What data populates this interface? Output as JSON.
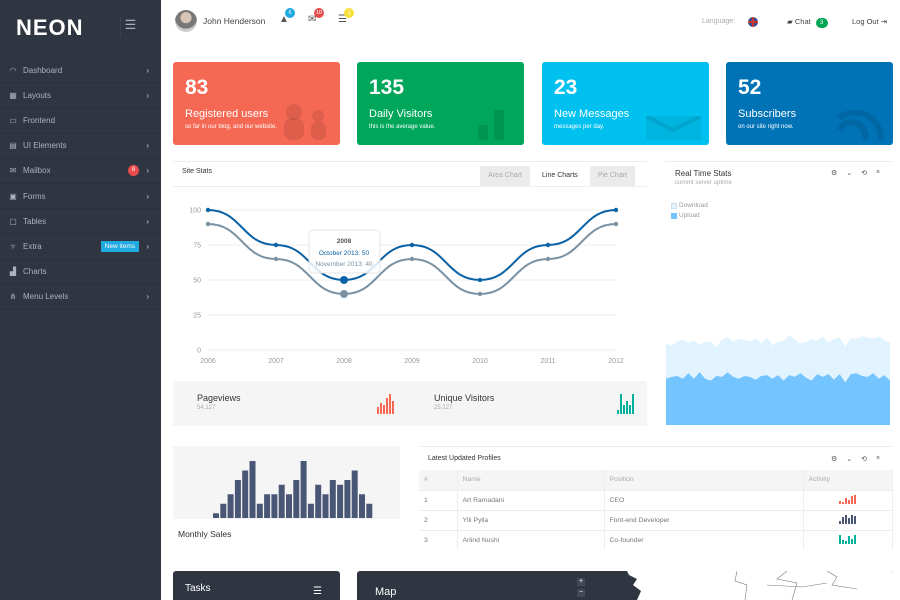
{
  "app": {
    "logo": "NEON",
    "menu_icon": "hamburger-icon"
  },
  "sidebar": {
    "items": [
      {
        "label": "Dashboard",
        "icon": "gauge-icon",
        "glyph": "◠",
        "chevron": true
      },
      {
        "label": "Layouts",
        "icon": "grid-icon",
        "glyph": "▦",
        "chevron": true
      },
      {
        "label": "Frontend",
        "icon": "monitor-icon",
        "glyph": "▭",
        "chevron": false
      },
      {
        "label": "UI Elements",
        "icon": "document-icon",
        "glyph": "▤",
        "chevron": true
      },
      {
        "label": "Mailbox",
        "icon": "mail-icon",
        "glyph": "✉",
        "chevron": true,
        "badge": "8"
      },
      {
        "label": "Forms",
        "icon": "form-icon",
        "glyph": "▣",
        "chevron": true
      },
      {
        "label": "Tables",
        "icon": "table-icon",
        "glyph": "▢",
        "chevron": true
      },
      {
        "label": "Extra",
        "icon": "box-icon",
        "glyph": "▿",
        "chevron": true,
        "tag": "New items"
      },
      {
        "label": "Charts",
        "icon": "bar-chart-icon",
        "glyph": "▟",
        "chevron": false
      },
      {
        "label": "Menu Levels",
        "icon": "sitemap-icon",
        "glyph": "⋔",
        "chevron": true
      }
    ]
  },
  "topbar": {
    "user": "John Henderson",
    "notifications": [
      {
        "icon": "alert-icon",
        "glyph": "▲",
        "count": "6",
        "color": "#21a9e1"
      },
      {
        "icon": "envelope-icon",
        "glyph": "✉",
        "count": "10",
        "color": "#e84c4c"
      },
      {
        "icon": "list-icon",
        "glyph": "☰",
        "count": "1",
        "color": "#f7e03a"
      }
    ],
    "language_label": "Language:",
    "chat_label": "Chat",
    "chat_count": "3",
    "logout_label": "Log Out"
  },
  "tiles": [
    {
      "value": "83",
      "title": "Registered users",
      "subtitle": "so far in our blog, and our website.",
      "color": "#f56954",
      "icon": "users-icon"
    },
    {
      "value": "135",
      "title": "Daily Visitors",
      "subtitle": "this is the average value.",
      "color": "#00a65a",
      "icon": "bar-chart-icon"
    },
    {
      "value": "23",
      "title": "New Messages",
      "subtitle": "messages per day.",
      "color": "#00c0ef",
      "icon": "envelope-icon"
    },
    {
      "value": "52",
      "title": "Subscribers",
      "subtitle": "on our site right now.",
      "color": "#0073b7",
      "icon": "rss-icon"
    }
  ],
  "site_stats": {
    "title": "Site Stats",
    "tabs": [
      "Area Chart",
      "Line Charts",
      "Pie Chart"
    ],
    "active_tab": 1,
    "tooltip": {
      "title": "2008",
      "line1": "October 2013: 50",
      "line2": "November 2013: 40"
    }
  },
  "chart_data": [
    {
      "type": "line",
      "title": "Site Stats",
      "x": [
        "2006",
        "2007",
        "2008",
        "2009",
        "2010",
        "2011",
        "2012"
      ],
      "series": [
        {
          "name": "October 2013",
          "values": [
            100,
            75,
            50,
            75,
            50,
            75,
            100
          ],
          "color": "#0b62a4"
        },
        {
          "name": "November 2013",
          "values": [
            90,
            65,
            40,
            65,
            40,
            65,
            90
          ],
          "color": "#7a92a3"
        }
      ],
      "yticks": [
        0,
        25,
        50,
        75,
        100
      ],
      "ylim": [
        0,
        100
      ],
      "grid": true,
      "highlight_index": 2
    },
    {
      "type": "area",
      "title": "Real Time Stats",
      "subtitle": "current server uptime",
      "legend": [
        "Download",
        "Upload"
      ],
      "legend_placement": "top-left",
      "series": [
        {
          "name": "Download",
          "color": "#e1f3ff",
          "values": [
            0.88,
            0.86,
            0.9,
            0.92,
            0.89,
            0.91,
            0.87,
            0.9,
            0.9,
            0.84,
            0.92,
            0.95,
            0.9,
            0.93,
            0.92,
            0.9,
            0.94,
            0.88,
            0.95,
            0.86,
            0.9,
            0.91,
            0.97,
            0.92,
            0.88,
            0.9,
            0.93,
            0.91,
            0.96,
            0.89,
            0.93,
            0.95,
            0.85,
            0.94,
            0.93,
            0.96,
            0.95,
            0.93,
            0.96,
            0.92,
            0.89
          ]
        },
        {
          "name": "Upload",
          "color": "#73c4ff",
          "values": [
            0.5,
            0.52,
            0.53,
            0.5,
            0.56,
            0.5,
            0.57,
            0.5,
            0.48,
            0.53,
            0.52,
            0.57,
            0.52,
            0.5,
            0.53,
            0.52,
            0.49,
            0.53,
            0.54,
            0.5,
            0.54,
            0.48,
            0.54,
            0.52,
            0.56,
            0.51,
            0.48,
            0.55,
            0.52,
            0.55,
            0.49,
            0.55,
            0.46,
            0.55,
            0.56,
            0.53,
            0.52,
            0.56,
            0.5,
            0.54,
            0.48
          ]
        }
      ]
    },
    {
      "type": "bar",
      "title": "Monthly Sales",
      "values": [
        1,
        3,
        5,
        8,
        10,
        12,
        3,
        5,
        5,
        7,
        5,
        8,
        12,
        3,
        7,
        5,
        8,
        7,
        8,
        10,
        5,
        3
      ],
      "color": "#4a5675"
    }
  ],
  "mini_stats": [
    {
      "label": "Pageviews",
      "value": "54,127",
      "color": "#f56954",
      "bars": [
        3,
        5,
        4,
        7,
        9,
        6
      ]
    },
    {
      "label": "Unique Visitors",
      "value": "25,127",
      "color": "#00b29e",
      "bars": [
        2,
        9,
        4,
        6,
        4,
        9
      ]
    }
  ],
  "real_time": {
    "title": "Real Time Stats",
    "subtitle": "current server uptime",
    "legend": [
      "Download",
      "Upload"
    ]
  },
  "profiles": {
    "title": "Latest Updated Profiles",
    "columns": [
      "#",
      "Name",
      "Position",
      "Activity"
    ],
    "rows": [
      {
        "num": "1",
        "name": "Art Ramadani",
        "position": "CEO",
        "color": "#f56954",
        "bars": [
          2,
          1,
          4,
          3,
          6,
          7
        ]
      },
      {
        "num": "2",
        "name": "Ylli Pylla",
        "position": "Font-end Developer",
        "color": "#4a5675",
        "bars": [
          2,
          5,
          7,
          4,
          7,
          6
        ]
      },
      {
        "num": "3",
        "name": "Arlind Nushi",
        "position": "Co-founder",
        "color": "#00b29e",
        "bars": [
          7,
          3,
          2,
          6,
          4,
          7
        ]
      }
    ]
  },
  "tasks": {
    "title": "Tasks"
  },
  "map": {
    "title": "Map",
    "zoom_in": "+",
    "zoom_out": "−"
  }
}
